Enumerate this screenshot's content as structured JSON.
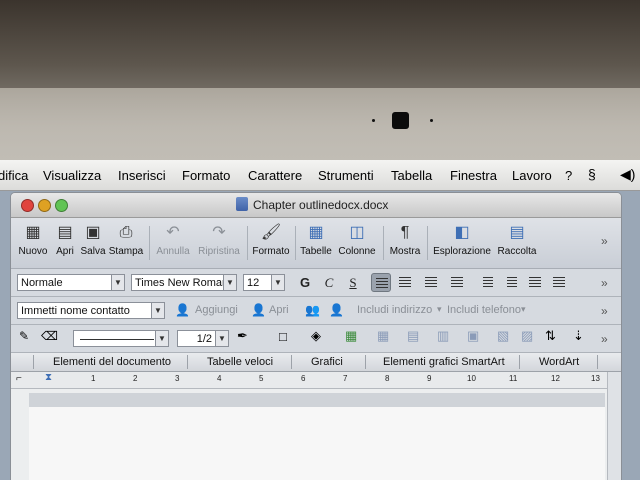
{
  "menubar": {
    "items": [
      "difica",
      "Visualizza",
      "Inserisci",
      "Formato",
      "Carattere",
      "Strumenti",
      "Tabella",
      "Finestra",
      "Lavoro",
      "?"
    ]
  },
  "window": {
    "title": "Chapter outlinedocx.docx"
  },
  "toolbar": {
    "nuovo": "Nuovo",
    "apri": "Apri",
    "salva": "Salva",
    "stampa": "Stampa",
    "annulla": "Annulla",
    "ripristina": "Ripristina",
    "formato": "Formato",
    "tabelle": "Tabelle",
    "colonne": "Colonne",
    "mostra": "Mostra",
    "esplorazione": "Esplorazione",
    "raccolta": "Raccolta"
  },
  "format_bar": {
    "style": "Normale",
    "font": "Times New Roman",
    "size": "12",
    "bold": "G",
    "italic": "C",
    "underline": "S"
  },
  "contact_bar": {
    "contact_placeholder": "Immetti nome contatto",
    "aggiungi": "Aggiungi",
    "apri": "Apri",
    "includi_indirizzo": "Includi indirizzo",
    "includi_telefono": "Includi telefono"
  },
  "draw_bar": {
    "line_weight": "1/2"
  },
  "ribbon_tabs": [
    "Elementi del documento",
    "Tabelle veloci",
    "Grafici",
    "Elementi grafici SmartArt",
    "WordArt"
  ],
  "ruler": {
    "numbers": [
      "1",
      "2",
      "3",
      "4",
      "5",
      "6",
      "7",
      "8",
      "9",
      "10",
      "11",
      "12",
      "13"
    ]
  },
  "colors": {
    "close": "#e0443e",
    "minimize": "#dea123",
    "zoom": "#61c454",
    "toolbar_bg": "#d6dae0"
  }
}
